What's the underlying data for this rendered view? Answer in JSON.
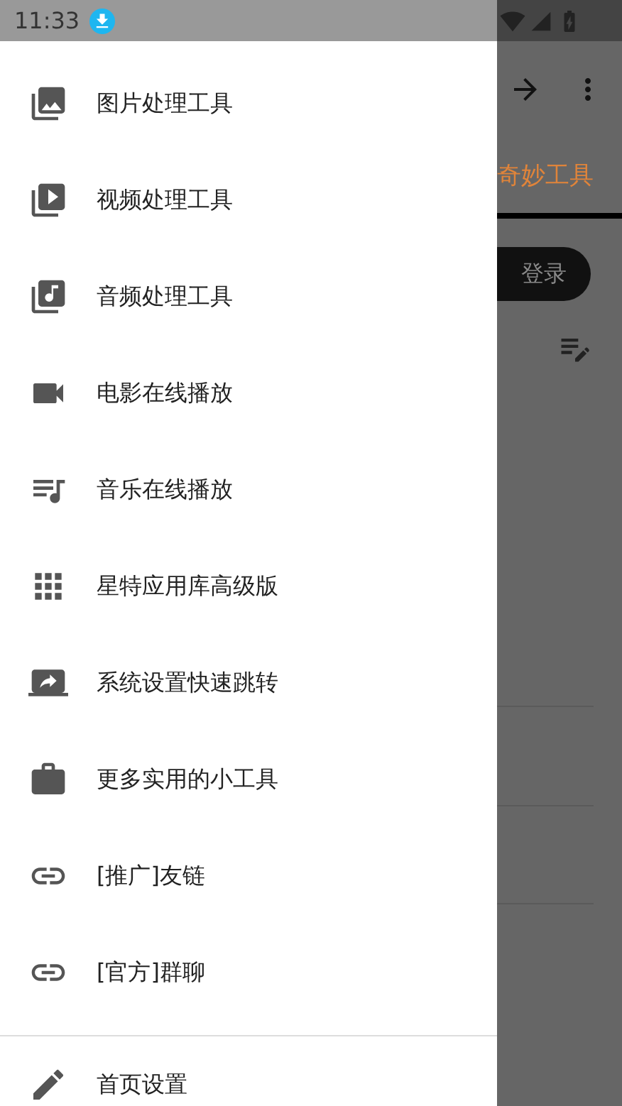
{
  "status_bar": {
    "time": "11:33"
  },
  "drawer": {
    "items": [
      {
        "label": "图片处理工具"
      },
      {
        "label": "视频处理工具"
      },
      {
        "label": "音频处理工具"
      },
      {
        "label": "电影在线播放"
      },
      {
        "label": "音乐在线播放"
      },
      {
        "label": "星特应用库高级版"
      },
      {
        "label": "系统设置快速跳转"
      },
      {
        "label": "更多实用的小工具"
      },
      {
        "label": "[推广]友链"
      },
      {
        "label": "[官方]群聊"
      }
    ],
    "footer_items": [
      {
        "label": "首页设置"
      }
    ]
  },
  "background": {
    "tab": "奇妙工具",
    "login_button": "登录"
  }
}
